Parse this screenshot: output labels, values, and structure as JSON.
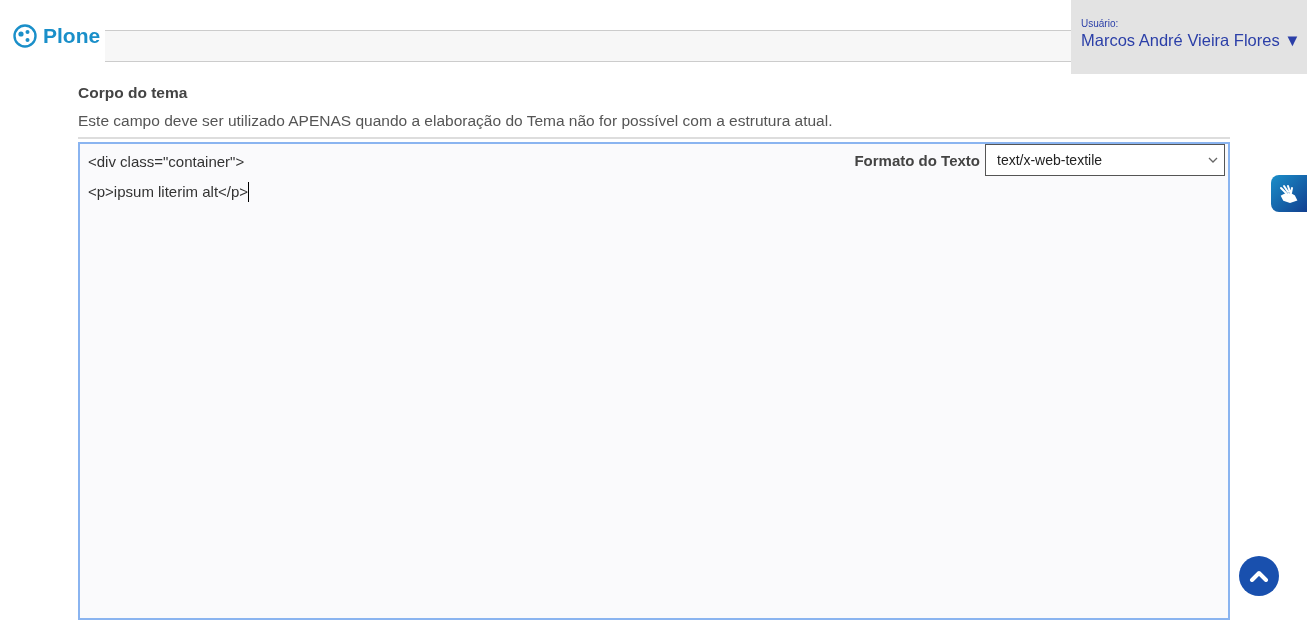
{
  "logo": {
    "text": "Plone"
  },
  "user": {
    "label": "Usuário:",
    "name": "Marcos André Vieira Flores",
    "caret": "▼"
  },
  "field": {
    "label": "Corpo do tema",
    "help": "Este campo deve ser utilizado APENAS quando a elaboração do Tema não for possível com a estrutura atual.",
    "format_label": "Formato do Texto",
    "format_value": "text/x-web-textile",
    "lines": [
      "<div class=\"container\">",
      "<p>ipsum literim alt</p>"
    ]
  }
}
